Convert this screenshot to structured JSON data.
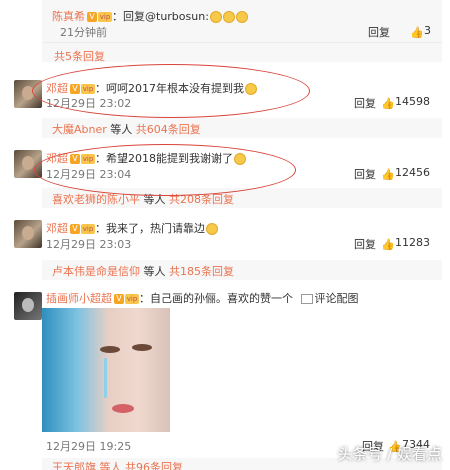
{
  "top_reply": {
    "name": "陈真希",
    "text": "：回复@turbosun:",
    "time": "21分钟前",
    "reply_label": "回复",
    "likes": "3"
  },
  "top_more": "共5条回复",
  "comments": [
    {
      "name": "邓超",
      "text": "：呵呵2017年根本没有提到我",
      "time": "12月29日 23:02",
      "reply_label": "回复",
      "likes": "14598",
      "more_name": "大魔Abner",
      "more_mid": " 等人 ",
      "more_count": "共604条回复"
    },
    {
      "name": "邓超",
      "text": "：希望2018能提到我谢谢了",
      "time": "12月29日 23:04",
      "reply_label": "回复",
      "likes": "12456",
      "more_name": "喜欢老狮的陈小平",
      "more_mid": " 等人 ",
      "more_count": "共208条回复"
    },
    {
      "name": "邓超",
      "text": "：我来了，热门请靠边",
      "time": "12月29日 23:03",
      "reply_label": "回复",
      "likes": "11283",
      "more_name": "卢本伟是命是信仰",
      "more_mid": " 等人 ",
      "more_count": "共185条回复"
    },
    {
      "name": "插画师小超超",
      "text": "：自己画的孙俪。喜欢的赞一个",
      "pic_label": "评论配图",
      "time": "12月29日 19:25",
      "reply_label": "回复",
      "likes": "7344"
    }
  ],
  "bottom_more": "王天郎旗 等人 共96条回复",
  "watermark": "头条号 / 娱看点",
  "colors": {
    "name": "#eb7350",
    "circle": "#d8453a",
    "subbox": "#f7f7f7"
  }
}
